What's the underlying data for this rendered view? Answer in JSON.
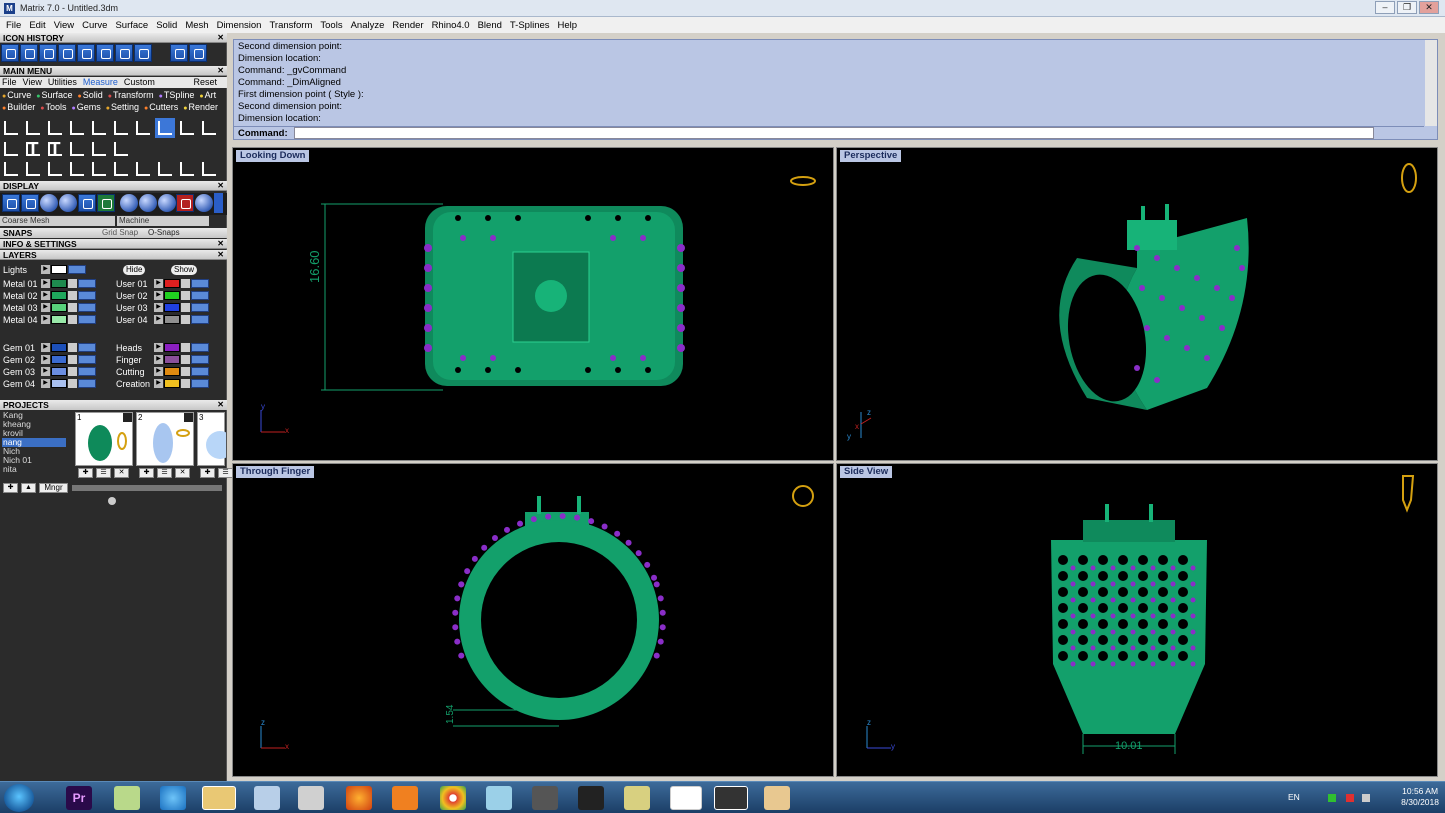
{
  "window": {
    "title": "Matrix 7.0 - Untitled.3dm",
    "buttons": [
      "–",
      "❐",
      "✕"
    ]
  },
  "menubar": [
    "File",
    "Edit",
    "View",
    "Curve",
    "Surface",
    "Solid",
    "Mesh",
    "Dimension",
    "Transform",
    "Tools",
    "Analyze",
    "Render",
    "Rhino4.0",
    "Blend",
    "T-Splines",
    "Help"
  ],
  "panels": {
    "icon_history": "ICON HISTORY",
    "main_menu": "MAIN MENU",
    "display": "DISPLAY",
    "snaps": "SNAPS",
    "info": "INFO & SETTINGS",
    "layers": "LAYERS",
    "projects": "PROJECTS"
  },
  "main_menu_tabs": [
    "File",
    "View",
    "Utilities",
    "Measure",
    "Custom"
  ],
  "main_menu_reset": "Reset",
  "categories_row1": [
    "Curve",
    "Surface",
    "Solid",
    "Transform",
    "TSpline",
    "Art"
  ],
  "categories_row2": [
    "Builder",
    "Tools",
    "Gems",
    "Setting",
    "Cutters",
    "Render"
  ],
  "category_colors": [
    "#e4a52b",
    "#36c36a",
    "#ff7f2a",
    "#d94c4c",
    "#b07cff",
    "#f0d23a"
  ],
  "display": {
    "coarse_mesh": "Coarse Mesh",
    "machine": "Machine"
  },
  "snaps": {
    "grid_snap": "Grid Snap",
    "o_snaps": "O-Snaps"
  },
  "layers": {
    "lights": "Lights",
    "hide": "Hide",
    "show": "Show",
    "left": [
      {
        "name": "Metal 01",
        "color": "#1e8a4e"
      },
      {
        "name": "Metal 02",
        "color": "#1fa75c"
      },
      {
        "name": "Metal 03",
        "color": "#58d07a"
      },
      {
        "name": "Metal 04",
        "color": "#98e8a8"
      },
      {
        "name": "Gem 01",
        "color": "#1c4fb8"
      },
      {
        "name": "Gem 02",
        "color": "#3a6ad0"
      },
      {
        "name": "Gem 03",
        "color": "#6a8de0"
      },
      {
        "name": "Gem 04",
        "color": "#a9c0ef"
      }
    ],
    "right": [
      {
        "name": "User 01",
        "color": "#e02020"
      },
      {
        "name": "User 02",
        "color": "#20d020"
      },
      {
        "name": "User 03",
        "color": "#2040e0"
      },
      {
        "name": "User 04",
        "color": "#909090"
      },
      {
        "name": "Heads",
        "color": "#8a1fc0"
      },
      {
        "name": "Finger",
        "color": "#8a4f9a"
      },
      {
        "name": "Cutting",
        "color": "#e08a10"
      },
      {
        "name": "Creation",
        "color": "#f0c020"
      }
    ]
  },
  "projects": {
    "list": [
      "Kang",
      "kheang",
      "krovil",
      "nang",
      "Nich",
      "Nich 01",
      "nita"
    ],
    "selected": "nang",
    "thumbnails": [
      "1",
      "2",
      "3"
    ],
    "mngr": "Mngr"
  },
  "command_history": [
    "Second dimension point:",
    "Dimension location:",
    "Command: _gvCommand",
    "Command: _DimAligned",
    "First dimension point ( Style ):",
    "Second dimension point:",
    "Dimension location:"
  ],
  "command_prompt": "Command:",
  "viewports": {
    "top_left": {
      "label": "Looking Down",
      "dimension": "16.60"
    },
    "top_right": {
      "label": "Perspective"
    },
    "bottom_left": {
      "label": "Through Finger",
      "dimension": "1.54"
    },
    "bottom_right": {
      "label": "Side View",
      "dimension": "10.01"
    }
  },
  "axes": {
    "x": "x",
    "y": "y",
    "z": "z"
  },
  "taskbar": {
    "language": "EN",
    "time": "10:56 AM",
    "date": "8/30/2018",
    "premiere": "Pr"
  }
}
